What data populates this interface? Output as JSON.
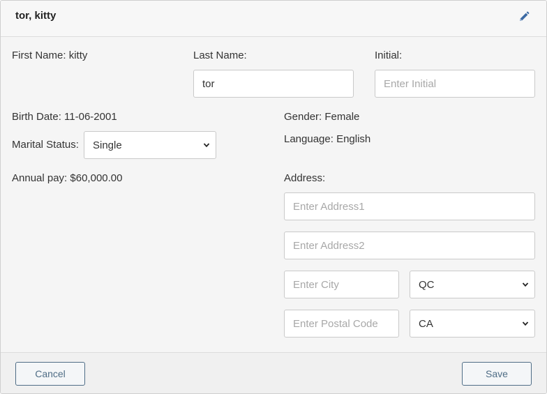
{
  "header": {
    "title": "tor, kitty",
    "edit_icon": "pencil-icon"
  },
  "form": {
    "first_name_label": "First Name:",
    "first_name_value": "kitty",
    "last_name_label": "Last Name:",
    "last_name_value": "tor",
    "initial_label": "Initial:",
    "initial_placeholder": "Enter Initial",
    "birth_date_label": "Birth Date:",
    "birth_date_value": "11-06-2001",
    "gender_label": "Gender:",
    "gender_value": "Female",
    "marital_status_label": "Marital Status:",
    "marital_status_value": "Single",
    "language_label": "Language:",
    "language_value": "English",
    "annual_pay_label": "Annual pay:",
    "annual_pay_value": "$60,000.00",
    "address_label": "Address:",
    "address1_placeholder": "Enter Address1",
    "address2_placeholder": "Enter Address2",
    "city_placeholder": "Enter City",
    "province_value": "QC",
    "postal_code_placeholder": "Enter Postal Code",
    "country_value": "CA"
  },
  "footer": {
    "cancel_label": "Cancel",
    "save_label": "Save"
  },
  "colors": {
    "button_border": "#4f6d86",
    "edit_icon": "#3d6aa3"
  }
}
